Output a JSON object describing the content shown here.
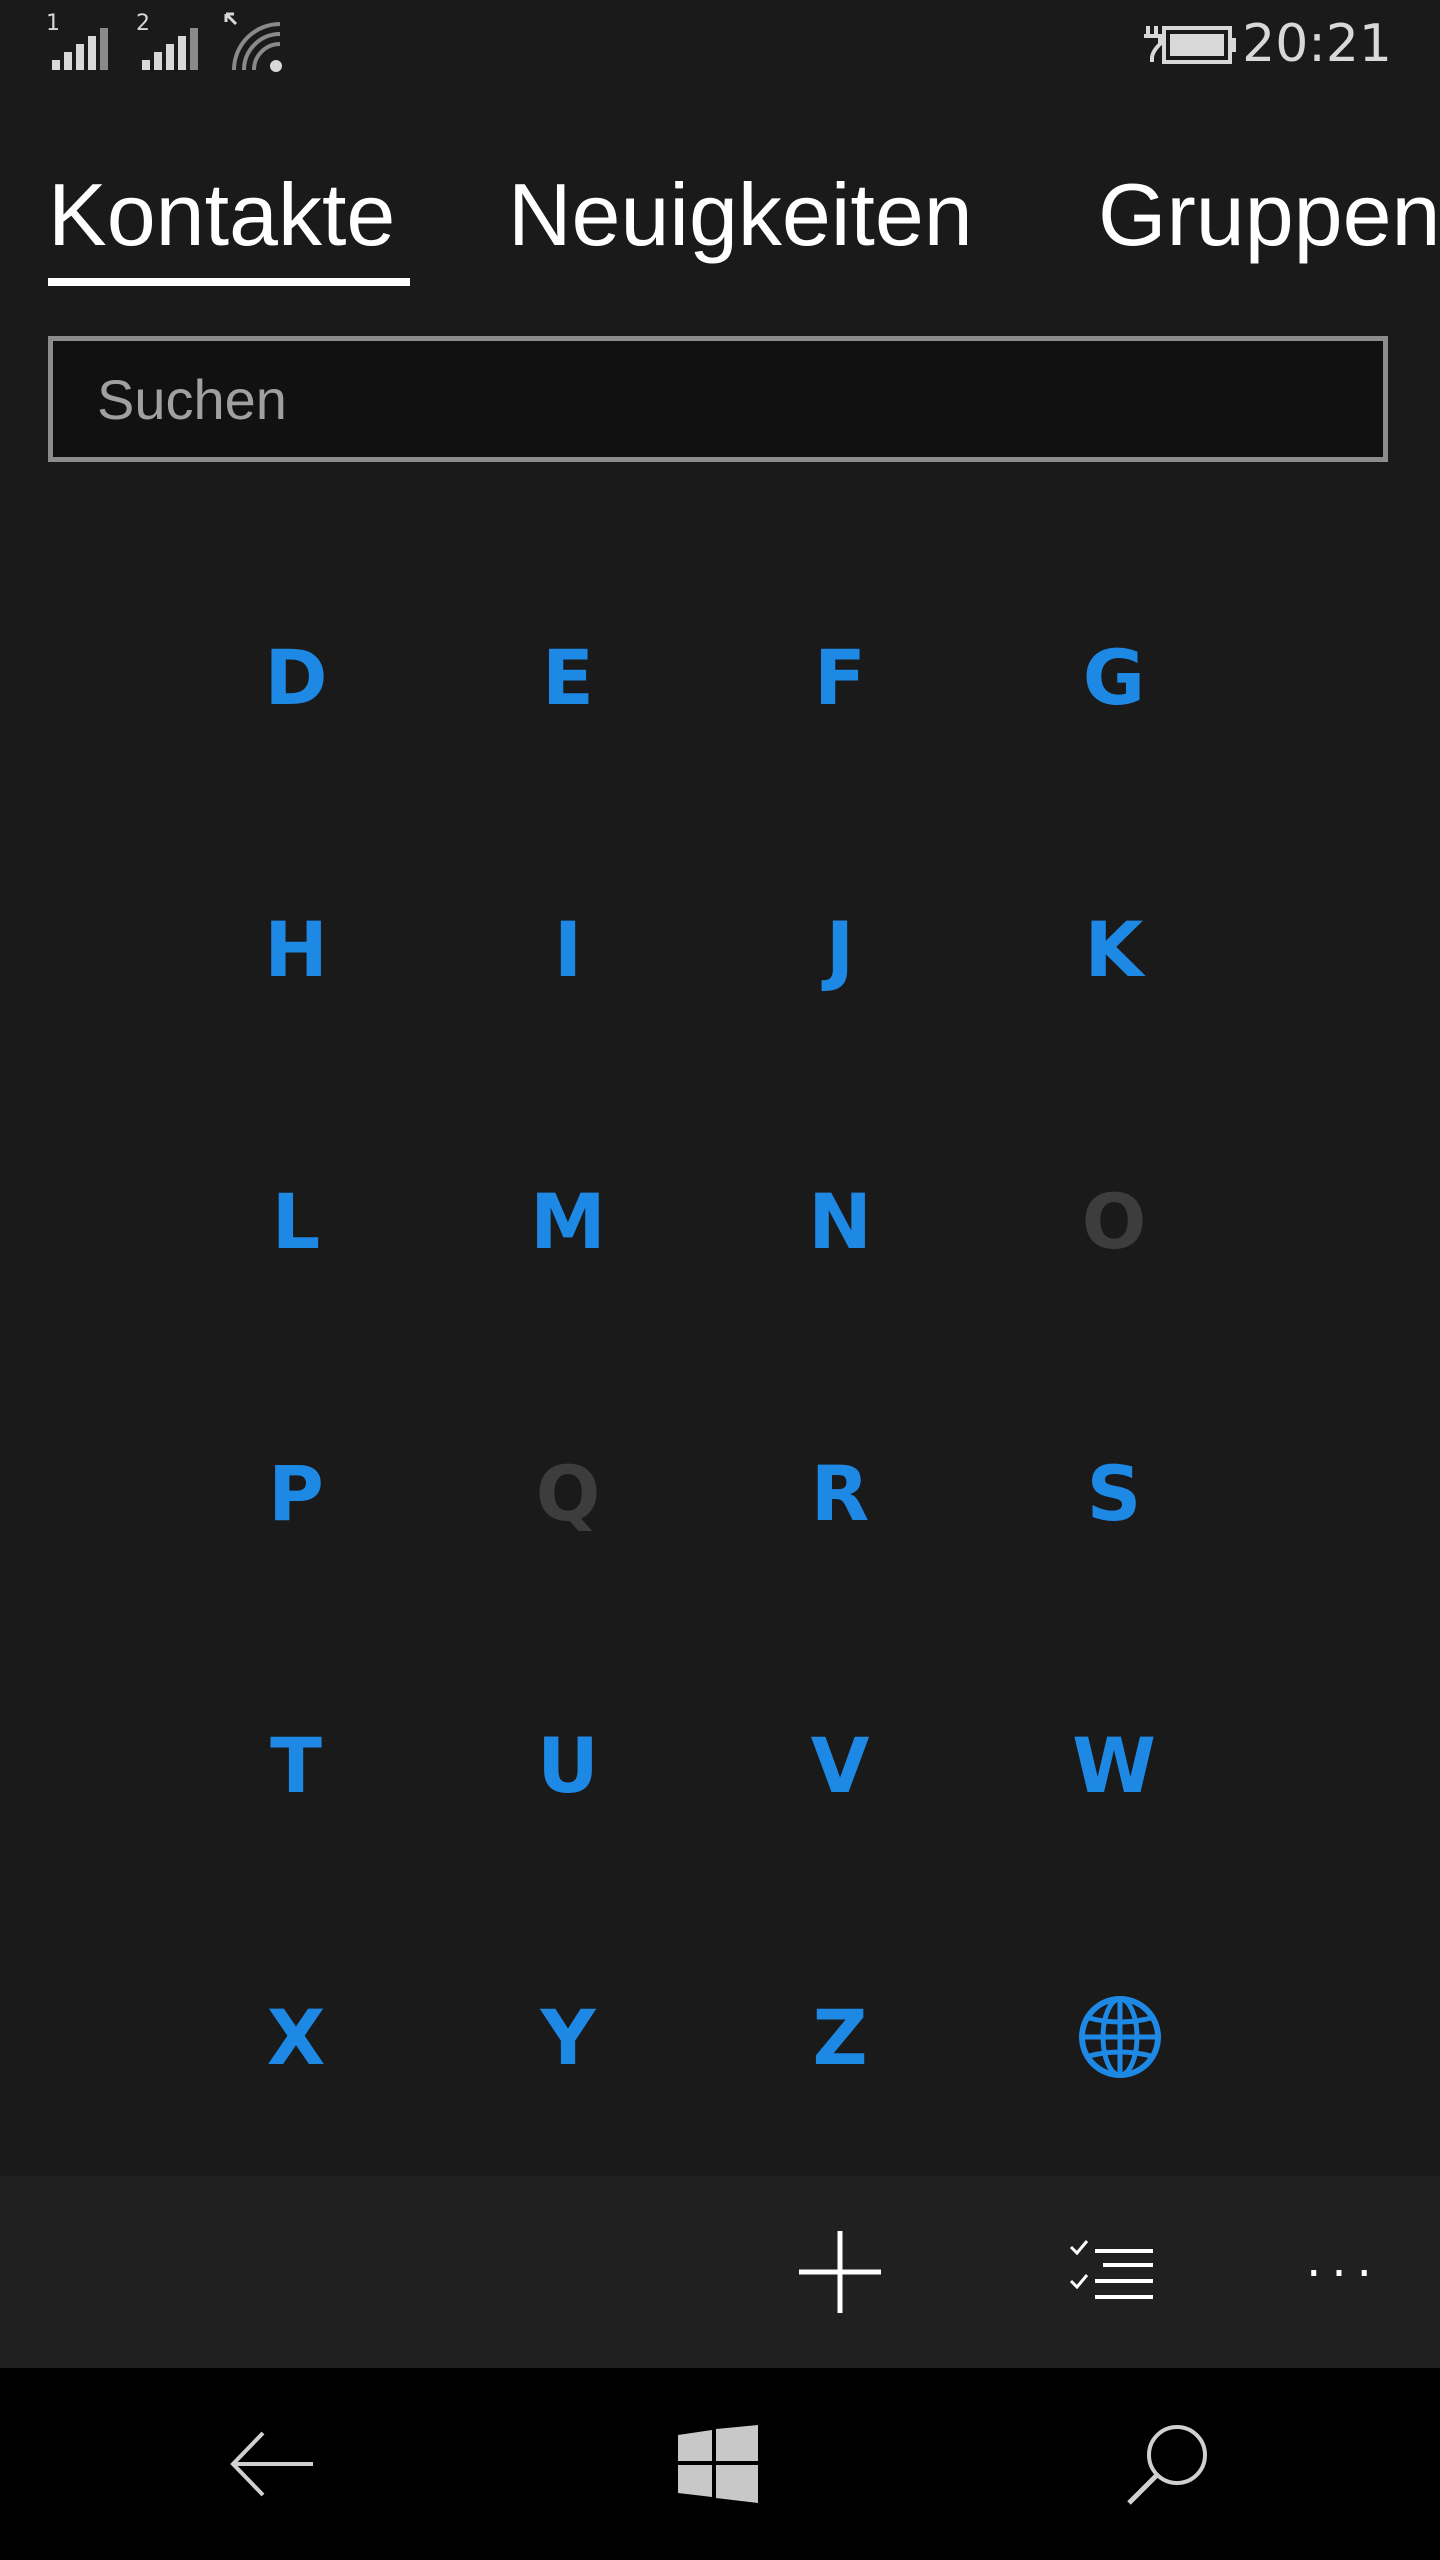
{
  "status_bar": {
    "sim1_label": "1",
    "sim2_label": "2",
    "time": "20:21",
    "icons": [
      "signal-sim1-icon",
      "signal-sim2-icon",
      "wifi-icon",
      "battery-charging-icon"
    ]
  },
  "pivot": {
    "tabs": [
      {
        "label": "Kontakte",
        "selected": true
      },
      {
        "label": "Neuigkeiten",
        "selected": false
      },
      {
        "label": "Gruppen",
        "selected": false
      }
    ]
  },
  "search": {
    "placeholder": "Suchen"
  },
  "jump_list": {
    "letters": [
      {
        "label": "D",
        "enabled": true
      },
      {
        "label": "E",
        "enabled": true
      },
      {
        "label": "F",
        "enabled": true
      },
      {
        "label": "G",
        "enabled": true
      },
      {
        "label": "H",
        "enabled": true
      },
      {
        "label": "I",
        "enabled": true
      },
      {
        "label": "J",
        "enabled": true
      },
      {
        "label": "K",
        "enabled": true
      },
      {
        "label": "L",
        "enabled": true
      },
      {
        "label": "M",
        "enabled": true
      },
      {
        "label": "N",
        "enabled": true
      },
      {
        "label": "O",
        "enabled": false
      },
      {
        "label": "P",
        "enabled": true
      },
      {
        "label": "Q",
        "enabled": false
      },
      {
        "label": "R",
        "enabled": true
      },
      {
        "label": "S",
        "enabled": true
      },
      {
        "label": "T",
        "enabled": true
      },
      {
        "label": "U",
        "enabled": true
      },
      {
        "label": "V",
        "enabled": true
      },
      {
        "label": "W",
        "enabled": true
      },
      {
        "label": "X",
        "enabled": true
      },
      {
        "label": "Y",
        "enabled": true
      },
      {
        "label": "Z",
        "enabled": true
      }
    ],
    "last_item_icon": "globe-icon"
  },
  "app_bar": {
    "buttons": [
      "add-icon",
      "select-list-icon",
      "more-icon"
    ],
    "more_label": "..."
  },
  "nav_bar": {
    "buttons": [
      "back-arrow-icon",
      "windows-logo-icon",
      "search-icon"
    ]
  },
  "colors": {
    "accent": "#1e88e5",
    "disabled": "#3d3d3d",
    "background": "#1a1a1a",
    "app_bar": "#202020",
    "nav_bar": "#000000"
  }
}
